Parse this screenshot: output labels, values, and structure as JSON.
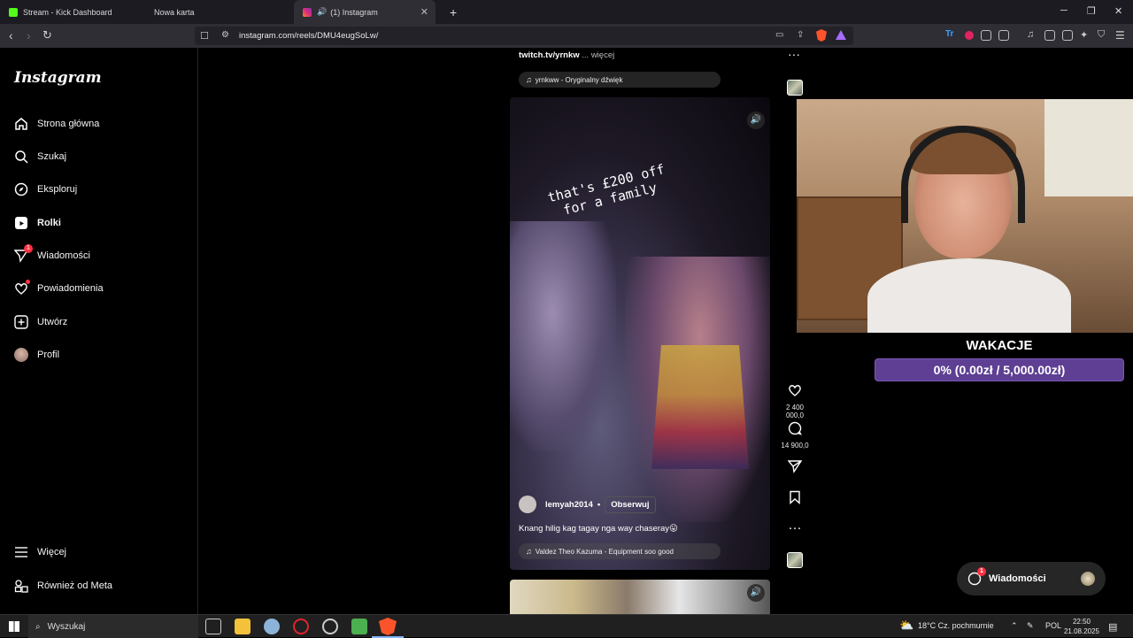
{
  "browser": {
    "tabs": [
      {
        "label": "Stream - Kick Dashboard",
        "favicon_color": "#53fc18"
      },
      {
        "label": "Nowa karta",
        "favicon_color": ""
      },
      {
        "label": "(1) Instagram",
        "favicon_color": "#e1306c"
      }
    ],
    "url": "instagram.com/reels/DMU4eugSoLw/",
    "window_controls": {
      "minimize": "─",
      "restore": "❐",
      "close": "✕"
    }
  },
  "sidebar": {
    "logo": "Instagram",
    "items": [
      {
        "label": "Strona główna"
      },
      {
        "label": "Szukaj"
      },
      {
        "label": "Eksploruj"
      },
      {
        "label": "Rolki"
      },
      {
        "label": "Wiadomości",
        "badge": "1"
      },
      {
        "label": "Powiadomienia"
      },
      {
        "label": "Utwórz"
      },
      {
        "label": "Profil"
      }
    ],
    "bottom": [
      {
        "label": "Więcej"
      },
      {
        "label": "Również od Meta"
      }
    ]
  },
  "reel_prev": {
    "caption_link": "twitch.tv/yrnkw",
    "more": "... więcej",
    "audio": "yrnkww - Oryginalny dźwięk"
  },
  "reel": {
    "overlay_line1": "that's £200 off",
    "overlay_line2": "for a family",
    "author": "lemyah2014",
    "separator": "•",
    "follow": "Obserwuj",
    "caption": "Knang hilig kag tagay nga way chaseray😛",
    "audio": "Valdez Theo Kazuma - Equipment soo good",
    "likes": "2 400 000,0",
    "comments": "14 900,0"
  },
  "donation": {
    "title": "WAKACJE",
    "text": "0% (0.00zł / 5,000.00zł)",
    "progress": 0
  },
  "messages_pill": {
    "label": "Wiadomości",
    "badge": "1"
  },
  "taskbar": {
    "search": "Wyszukaj",
    "weather": "18°C  Cz. pochmurnie",
    "lang": "POL",
    "time": "22:50",
    "date": "21.08.2025"
  }
}
